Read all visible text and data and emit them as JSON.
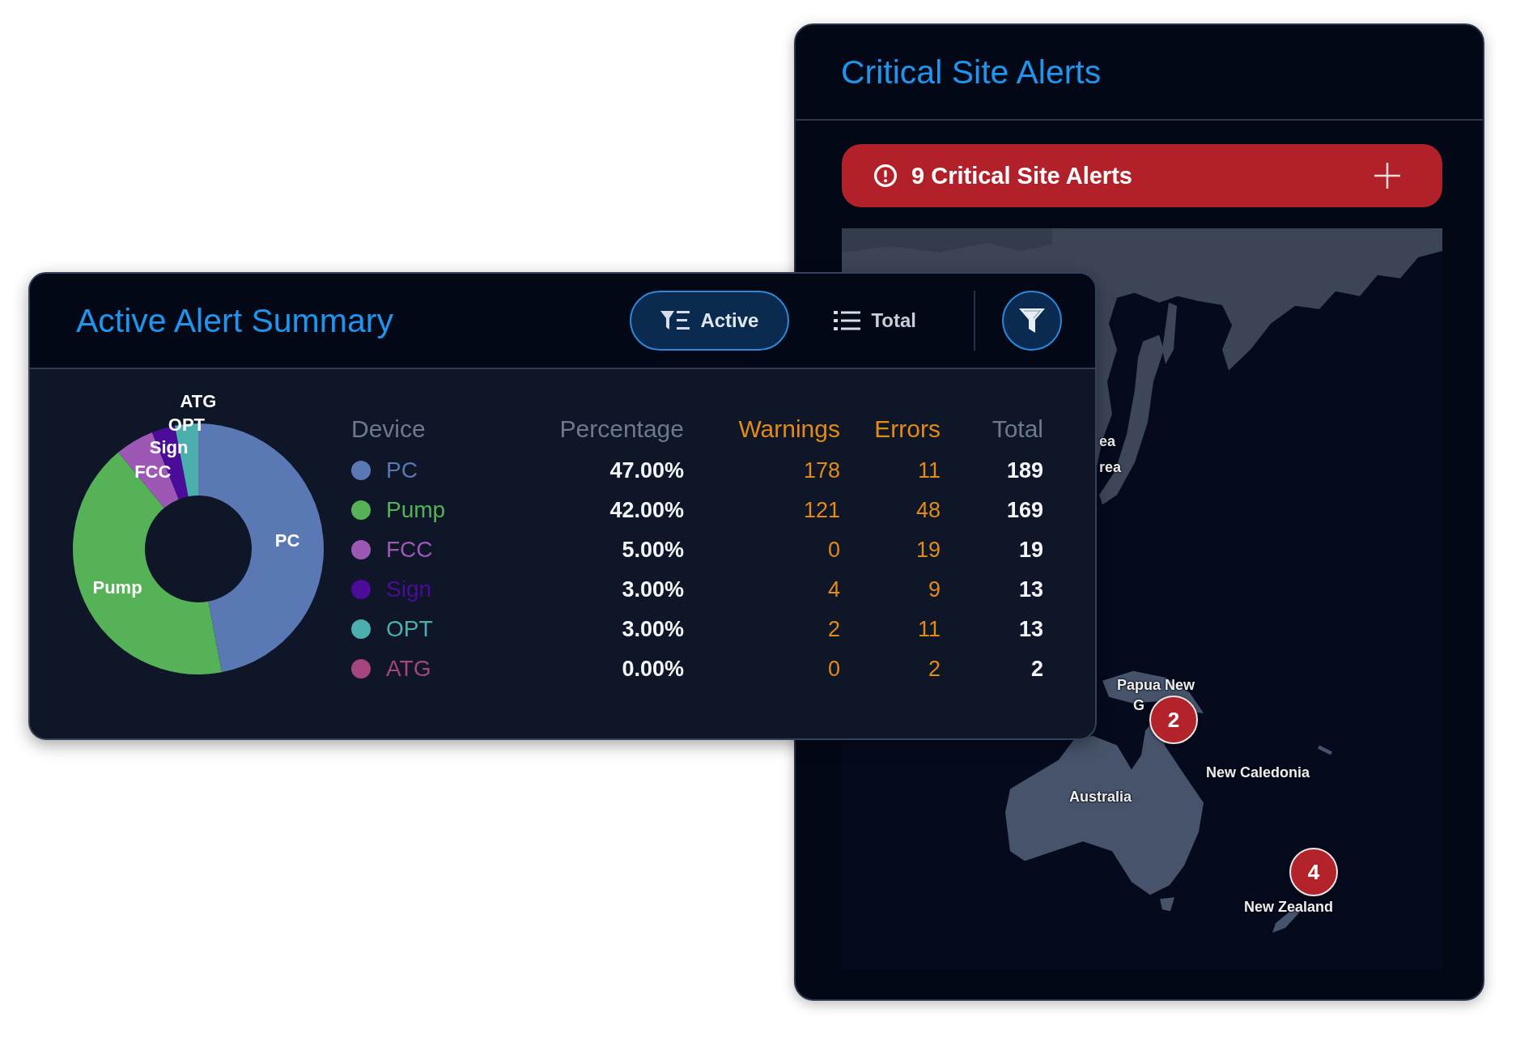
{
  "critical_site_alerts": {
    "title": "Critical Site Alerts",
    "banner": {
      "label": "9 Critical Site Alerts",
      "expanded": false
    },
    "map": {
      "labels": [
        "ea",
        "rea",
        "Papua New",
        "G",
        "New Caledonia",
        "Australia",
        "New Zealand"
      ],
      "markers": [
        "2",
        "4"
      ]
    }
  },
  "active_alert_summary": {
    "title": "Active Alert Summary",
    "view_toggle": [
      {
        "label": "Active",
        "selected": true
      },
      {
        "label": "Total",
        "selected": false
      }
    ],
    "chart_data": {
      "type": "donut",
      "categories": [
        "PC",
        "Pump",
        "FCC",
        "Sign",
        "OPT",
        "ATG"
      ],
      "values": [
        47,
        42,
        5,
        3,
        3,
        0
      ]
    },
    "table": {
      "columns": [
        {
          "label": "Device",
          "color": "#6c7a8f"
        },
        {
          "label": "Percentage",
          "color": "#6c7a8f"
        },
        {
          "label": "Warnings",
          "color": "#e38b17"
        },
        {
          "label": "Errors",
          "color": "#e38b17"
        },
        {
          "label": "Total",
          "color": "#6c7a8f"
        }
      ],
      "rows": [
        {
          "color": "#5a78b4",
          "cells": [
            "PC",
            "47.00%",
            "178",
            "11",
            "189"
          ]
        },
        {
          "color": "#56b257",
          "cells": [
            "Pump",
            "42.00%",
            "121",
            "48",
            "169"
          ]
        },
        {
          "color": "#9d58b5",
          "cells": [
            "FCC",
            "5.00%",
            "0",
            "19",
            "19"
          ]
        },
        {
          "color": "#4c0c9a",
          "cells": [
            "Sign",
            "3.00%",
            "4",
            "9",
            "13"
          ]
        },
        {
          "color": "#4bb0ad",
          "cells": [
            "OPT",
            "3.00%",
            "2",
            "11",
            "13"
          ]
        },
        {
          "color": "#a4457f",
          "cells": [
            "ATG",
            "0.00%",
            "0",
            "2",
            "2"
          ]
        }
      ]
    }
  }
}
